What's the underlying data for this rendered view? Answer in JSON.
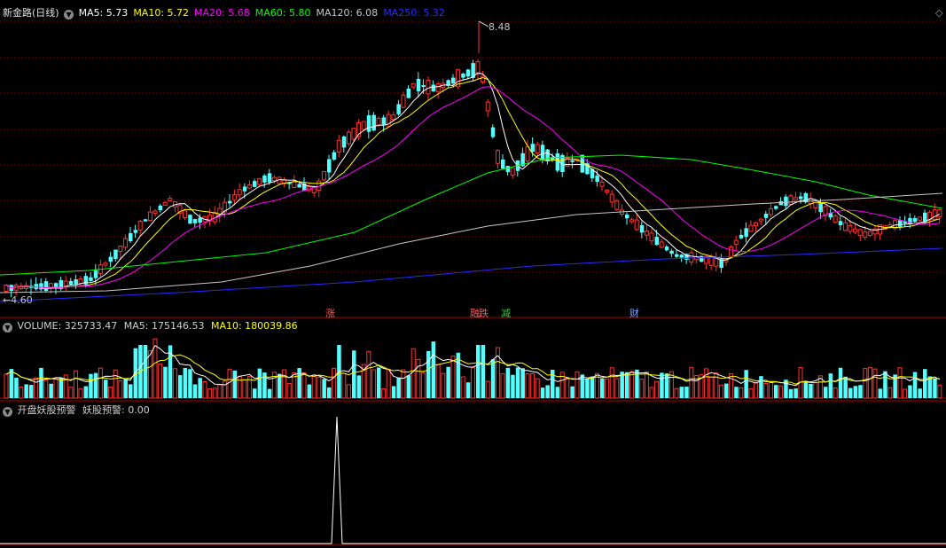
{
  "colors": {
    "background": "#000000",
    "rise": "#ff3232",
    "fall": "#54ffff",
    "grid": "#8b0000",
    "separator": "#b00000",
    "ma5": "#ffffff",
    "ma10": "#ffff00",
    "ma20": "#ff00ff",
    "ma60": "#00ff00",
    "ma120": "#c8c8c8",
    "ma250": "#2a2aff",
    "text": "#c0c0c0"
  },
  "main_panel": {
    "title": "新金路(日线)",
    "legend": [
      {
        "label": "MA5: 5.73",
        "color_key": "ma5"
      },
      {
        "label": "MA10: 5.72",
        "color_key": "ma10"
      },
      {
        "label": "MA20: 5.68",
        "color_key": "ma20"
      },
      {
        "label": "MA60: 5.80",
        "color_key": "ma60"
      },
      {
        "label": "MA120: 6.08",
        "color_key": "ma120"
      },
      {
        "label": "MA250: 5.32",
        "color_key": "ma250"
      }
    ],
    "high_label": "8.48",
    "low_label": "4.60",
    "event_tags": [
      {
        "text": "涨",
        "color": "#ff5a5a"
      },
      {
        "text": "融",
        "color": "#ff5a5a"
      },
      {
        "text": "跌",
        "color": "#ff5a5a"
      },
      {
        "text": "减",
        "color": "#3cc93c"
      },
      {
        "text": "财",
        "color": "#7ea6ff"
      }
    ],
    "collapse_icon": "diamond-icon"
  },
  "volume_panel": {
    "title": "VOLUME: 325733.47",
    "ma5": "MA5: 175146.53",
    "ma10": "MA10: 180039.86",
    "collapse_icon": "chevron-down-icon"
  },
  "indicator_panel": {
    "title": "开盘妖股预警",
    "value_label": "妖股预警: 0.00",
    "collapse_icon": "chevron-down-icon"
  }
}
